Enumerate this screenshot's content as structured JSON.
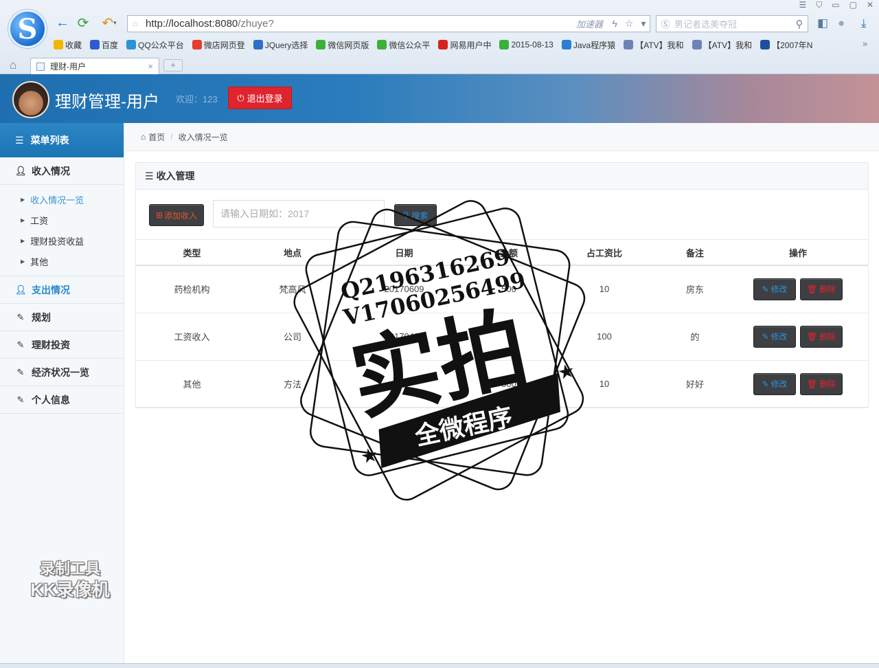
{
  "browser": {
    "url_main": "http://localhost:8080",
    "url_path": "/zhuye?",
    "accelerator": "加速器",
    "search_placeholder": "男记者选美夺冠",
    "bookmarks": [
      {
        "label": "收藏",
        "icon": "star-icon",
        "color": "#f1b700"
      },
      {
        "label": "百度",
        "icon": "baidu-icon",
        "color": "#2f5bd1"
      },
      {
        "label": "QQ公众平台",
        "icon": "qq-icon",
        "color": "#2c93d6"
      },
      {
        "label": "微店网页登",
        "icon": "weidian-icon",
        "color": "#e63b2e"
      },
      {
        "label": "JQuery选择",
        "icon": "jquery-icon",
        "color": "#2e6fc8"
      },
      {
        "label": "微信网页版",
        "icon": "wechat-icon",
        "color": "#3db03a"
      },
      {
        "label": "微信公众平",
        "icon": "wechat-mp-icon",
        "color": "#3db03a"
      },
      {
        "label": "网易用户中",
        "icon": "netease-icon",
        "color": "#d7231d"
      },
      {
        "label": "2015-08-13",
        "icon": "play-icon",
        "color": "#3ab03e"
      },
      {
        "label": "Java程序猿",
        "icon": "java-icon",
        "color": "#2b7fd0"
      },
      {
        "label": "【ATV】我和",
        "icon": "atv-icon",
        "color": "#6a84b7"
      },
      {
        "label": "【ATV】我和",
        "icon": "atv-icon",
        "color": "#6a84b7"
      },
      {
        "label": "【2007年N",
        "icon": "bo-icon",
        "color": "#1d4f9e"
      }
    ],
    "tab_label": "理财-用户",
    "new_tab": "+"
  },
  "header": {
    "title": "理财管理-用户",
    "welcome": "欢迎：123",
    "logout_label": "退出登录"
  },
  "sidebar": {
    "menu_title": "菜单列表",
    "groups": [
      {
        "label": "收入情况",
        "icon": "user-icon"
      },
      {
        "label": "支出情况",
        "icon": "user-icon"
      },
      {
        "label": "规划",
        "icon": "edit-icon"
      },
      {
        "label": "理财投资",
        "icon": "edit-icon"
      },
      {
        "label": "经济状况一览",
        "icon": "edit-icon"
      },
      {
        "label": "个人信息",
        "icon": "edit-icon"
      }
    ],
    "income_sub": [
      "收入情况一览",
      "工资",
      "理财投资收益",
      "其他"
    ]
  },
  "breadcrumb": {
    "home": "首页",
    "current": "收入情况一览"
  },
  "panel": {
    "title": "收入管理",
    "add_label": "添加收入",
    "search_placeholder": "请输入日期如：2017",
    "search_label": "搜索"
  },
  "table": {
    "headers": [
      "类型",
      "地点",
      "日期",
      "金额",
      "占工资比",
      "备注",
      "操作"
    ],
    "rows": [
      [
        "药检机构",
        "梵高风",
        "20170609",
        "500",
        "10",
        "房东"
      ],
      [
        "工资收入",
        "公司",
        "20170421",
        "",
        "100",
        "的"
      ],
      [
        "其他",
        "方法",
        "",
        "500",
        "10",
        "好好"
      ]
    ],
    "edit_label": "修改",
    "delete_label": "删除"
  },
  "watermark": {
    "line1": "Q2196316269",
    "line2": "V17060256499",
    "big": "实拍",
    "banner": "全微程序"
  },
  "recorder": {
    "line1": "录制工具",
    "line2": "KK录像机"
  }
}
